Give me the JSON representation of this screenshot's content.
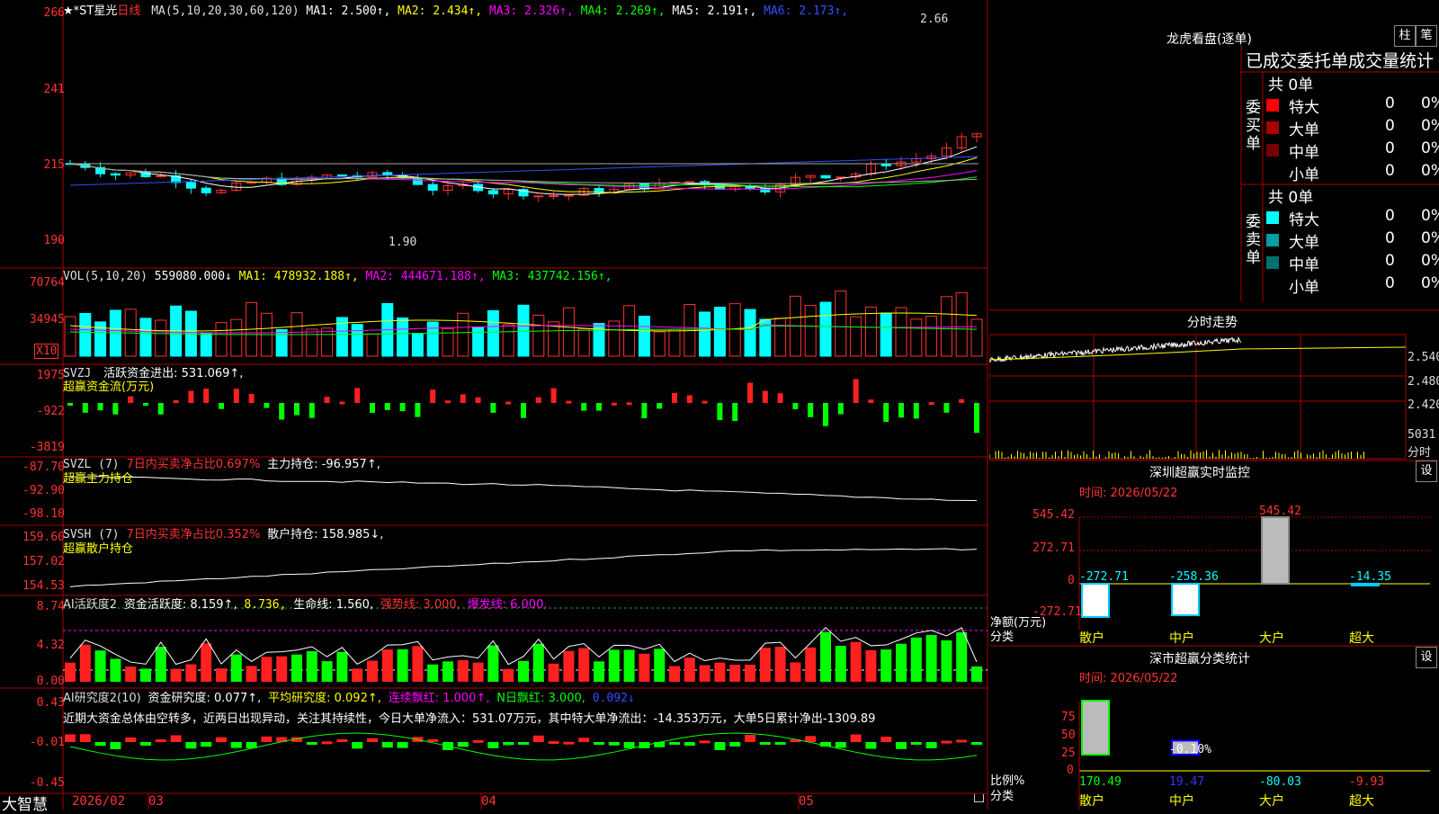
{
  "stock": {
    "name": "★*ST星光",
    "period": "日线",
    "ma_label": "MA(5,10,20,30,60,120)",
    "ma": [
      {
        "k": "MA1: 2.500↑",
        "color": "#ffffff"
      },
      {
        "k": "MA2: 2.434↑",
        "color": "#ffff00"
      },
      {
        "k": "MA3: 2.326↑",
        "color": "#ff00ff"
      },
      {
        "k": "MA4: 2.269↑",
        "color": "#00ff00"
      },
      {
        "k": "MA5: 2.191↑",
        "color": "#ffffff"
      },
      {
        "k": "MA6: 2.173↑",
        "color": "#3050ff"
      }
    ],
    "y_labels": [
      "266",
      "241",
      "215",
      "190"
    ],
    "high_label": "2.66",
    "low_label": "1.90"
  },
  "vol": {
    "label": "VOL(5,10,20)",
    "value": "559080.000↓",
    "ma": [
      {
        "k": "MA1: 478932.188↑",
        "color": "#ffff00"
      },
      {
        "k": "MA2: 444671.188↑",
        "color": "#ff00ff"
      },
      {
        "k": "MA3: 437742.156↑",
        "color": "#00ff00"
      }
    ],
    "y_labels": [
      "70764",
      "34945"
    ],
    "unit": "X10"
  },
  "svzj": {
    "label": "SVZJ",
    "line": "活跃资金进出: 531.069↑,",
    "sub": "超赢资金流(万元)",
    "y_labels": [
      "1975",
      "-922",
      "-3819"
    ]
  },
  "svzl": {
    "label": "SVZL (7)",
    "ratio": "7日内买卖净占比0.697%",
    "hold": "主力持仓: -96.957↑,",
    "sub": "超赢主力持仓",
    "y_labels": [
      "-87.70",
      "-92.90",
      "-98.10"
    ]
  },
  "svsh": {
    "label": "SVSH (7)",
    "ratio": "7日内买卖净占比0.352%",
    "hold": "散户持仓: 158.985↓,",
    "sub": "超赢散户持仓",
    "y_labels": [
      "159.60",
      "157.02",
      "154.53"
    ]
  },
  "ai_active": {
    "label": "AI活跃度2",
    "v1": "资金活跃度: 8.159↑,",
    "v2": "8.736,",
    "v3": "生命线: 1.560,",
    "v4": "强势线: 3.000,",
    "v5": "爆发线: 6.000,",
    "y_labels": [
      "8.74",
      "4.32",
      "0.00"
    ]
  },
  "ai_research": {
    "label": "AI研究度2(10)",
    "v1": "资金研究度: 0.077↑,",
    "v2": "平均研究度: 0.092↑,",
    "v3": "连续飘红: 1.000↑,",
    "v4": "N日飘红: 3.000,",
    "v5": "0.092↓",
    "comment": "近期大资金总体由空转多，近两日出现异动，关注其持续性，今日大单净流入：531.07万元，其中特大单净流出：-14.353万元，大单5日累计净出-1309.89",
    "y_labels": [
      "0.43",
      "-0.01",
      "-0.45"
    ]
  },
  "xaxis": {
    "brand": "大智慧",
    "labels": [
      "2026/02",
      "03",
      "04",
      "05"
    ]
  },
  "longhu": {
    "title": "龙虎看盘(逐单)",
    "btn1": "柱",
    "btn2": "笔",
    "header": "已成交委托单成交量统计",
    "buy_group": "委买单",
    "sell_group": "委卖单",
    "buy_total": "共 0单",
    "sell_total": "共 0单",
    "buy_rows": [
      {
        "name": "特大",
        "v1": "0",
        "v2": "0%",
        "color": "#ff0000"
      },
      {
        "name": "大单",
        "v1": "0",
        "v2": "0%",
        "color": "#aa0000"
      },
      {
        "name": "中单",
        "v1": "0",
        "v2": "0%",
        "color": "#770000"
      },
      {
        "name": "小单",
        "v1": "0",
        "v2": "0%",
        "color": ""
      }
    ],
    "sell_rows": [
      {
        "name": "特大",
        "v1": "0",
        "v2": "0%",
        "color": "#00ffff"
      },
      {
        "name": "大单",
        "v1": "0",
        "v2": "0%",
        "color": "#00a0a0"
      },
      {
        "name": "中单",
        "v1": "0",
        "v2": "0%",
        "color": "#007070"
      },
      {
        "name": "小单",
        "v1": "0",
        "v2": "0%",
        "color": ""
      }
    ]
  },
  "intraday": {
    "title": "分时走势",
    "y_labels": [
      "2.540",
      "2.480",
      "2.420",
      "5031",
      "分时"
    ]
  },
  "monitor": {
    "title": "深圳超赢实时监控",
    "btn": "设",
    "time": "时间: 2026/05/22",
    "y_labels": [
      "545.42",
      "272.71",
      "0",
      "-272.71"
    ],
    "axis_label": "净额(万元)",
    "axis_label2": "分类",
    "categories": [
      "散户",
      "中户",
      "大户",
      "超大"
    ],
    "values": [
      -272.71,
      -258.36,
      545.42,
      -14.35
    ],
    "value_labels": [
      "-272.71",
      "-258.36",
      "545.42",
      "-14.35"
    ]
  },
  "classify": {
    "title": "深市超赢分类统计",
    "btn": "设",
    "time": "时间: 2026/05/22",
    "y_labels": [
      "75",
      "50",
      "25",
      "0"
    ],
    "axis_label": "比例%",
    "axis_label2": "分类",
    "categories": [
      "散户",
      "中户",
      "大户",
      "超大"
    ],
    "values": [
      170.49,
      19.47,
      -80.03,
      -9.93
    ],
    "value_labels": [
      "170.49",
      "19.47",
      "-80.03",
      "-9.93"
    ],
    "mid_label": "-0.10%"
  }
}
